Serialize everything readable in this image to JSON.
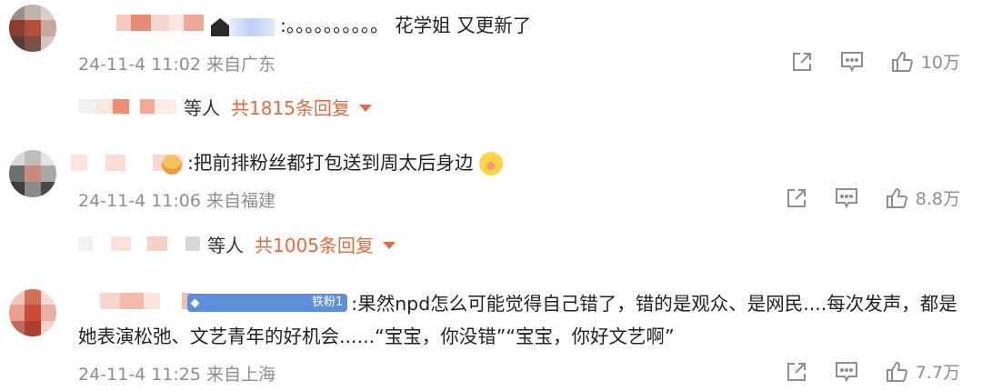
{
  "comments": [
    {
      "text": ":。。。。。。。。。。 花学姐 又更新了",
      "meta": "24-11-4 11:02 来自广东",
      "likes": "10万",
      "reply_suffix": "等人",
      "reply_total": "共1815条回复"
    },
    {
      "text": ":把前排粉丝都打包送到周太后身边",
      "meta": "24-11-4 11:06 来自福建",
      "likes": "8.8万",
      "reply_suffix": "等人",
      "reply_total": "共1005条回复"
    },
    {
      "badge": "铁粉1",
      "text": ":果然npd怎么可能觉得自己错了，错的是观众、是网民....每次发声，都是她表演松弛、文艺青年的好机会......“宝宝，你没错”“宝宝，你好文艺啊”",
      "meta": "24-11-4 11:25 来自上海",
      "likes": "7.7万"
    }
  ],
  "icons": {
    "share": "share-icon",
    "comment": "comment-icon",
    "like": "thumbs-up-icon"
  },
  "colors": {
    "accent": "#e86a3c",
    "meta": "#8e8e8e",
    "badge": "#5e8fd8"
  }
}
